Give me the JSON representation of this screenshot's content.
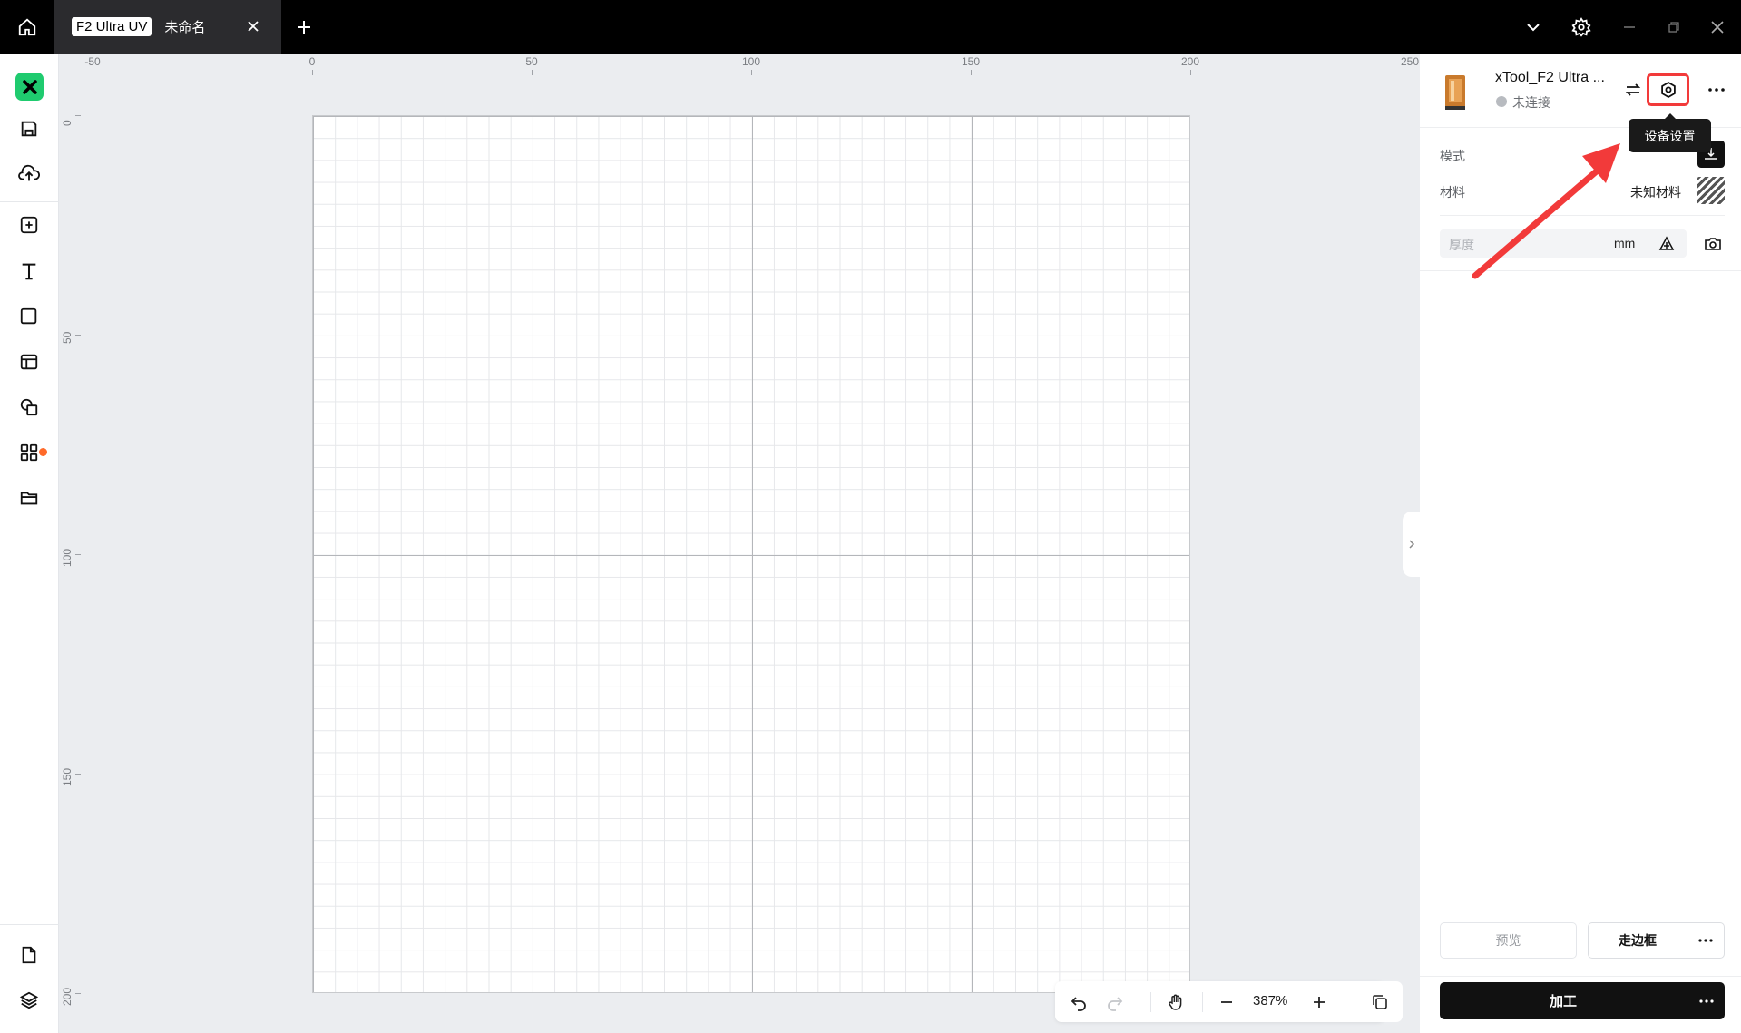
{
  "tab": {
    "badge": "F2 Ultra UV",
    "name": "未命名"
  },
  "ruler": {
    "top_labels": [
      "-50",
      "0",
      "50",
      "100",
      "150",
      "200",
      "250"
    ],
    "left_labels": [
      "0",
      "50",
      "100",
      "150",
      "200"
    ]
  },
  "zoom": {
    "value": "387%"
  },
  "device": {
    "name": "xTool_F2 Ultra ...",
    "status": "未连接"
  },
  "tooltip": {
    "text": "设备设置"
  },
  "settings": {
    "mode_label": "模式",
    "material_label": "材料",
    "material_value": "未知材料",
    "thickness_placeholder": "厚度",
    "thickness_unit": "mm"
  },
  "actions": {
    "preview": "预览",
    "frame": "走边框",
    "process": "加工"
  },
  "colors": {
    "accent": "#1fcb6f",
    "highlight": "#f23a3a",
    "notify_dot": "#ff6a2a"
  }
}
